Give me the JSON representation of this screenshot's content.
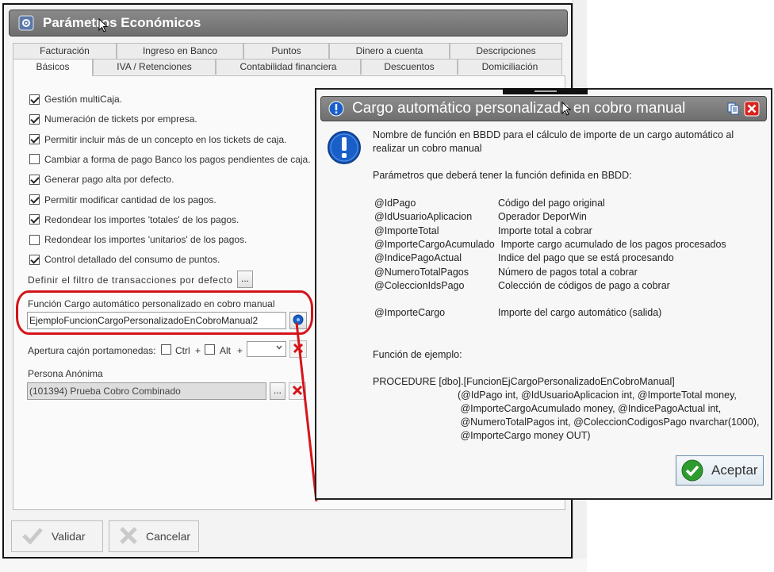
{
  "main_window": {
    "title": "Parámetros Económicos",
    "tabs_row1": [
      "Facturación",
      "Ingreso en Banco",
      "Puntos",
      "Dinero a cuenta",
      "Descripciones"
    ],
    "tabs_row2": [
      "Básicos",
      "IVA / Retenciones",
      "Contabilidad financiera",
      "Descuentos",
      "Domiciliación"
    ],
    "active_tab": "Básicos",
    "checkboxes": [
      {
        "label": "Gestión multiCaja.",
        "checked": true
      },
      {
        "label": "Numeración de tickets por empresa.",
        "checked": true
      },
      {
        "label": "Permitir incluir más de un concepto en los tickets de caja.",
        "checked": true
      },
      {
        "label": "Cambiar a forma de pago Banco los pagos pendientes de caja.",
        "checked": false
      },
      {
        "label": "Generar pago alta por defecto.",
        "checked": true
      },
      {
        "label": "Permitir modificar cantidad de los pagos.",
        "checked": true
      },
      {
        "label": "Redondear los importes 'totales' de los pagos.",
        "checked": true
      },
      {
        "label": "Redondear los importes 'unitarios' de los pagos.",
        "checked": false
      },
      {
        "label": "Control detallado del consumo de puntos.",
        "checked": true
      }
    ],
    "filter_label": "Definir el filtro de transacciones por defecto",
    "ellipsis": "...",
    "function_label": "Función Cargo automático personalizado en cobro manual",
    "function_value": "EjemploFuncionCargoPersonalizadoEnCobroManual2",
    "drawer_label": "Apertura cajón portamonedas:",
    "ctrl_label": "Ctrl",
    "alt_label": "Alt",
    "plus": "+",
    "anon_label": "Persona Anónima",
    "anon_value": "(101394) Prueba Cobro Combinado",
    "validate_label": "Validar",
    "cancel_label": "Cancelar"
  },
  "dialog": {
    "title": "Cargo automático personalizado en cobro manual",
    "intro_1": "Nombre de función en BBDD para el cálculo de importe de un cargo automático al",
    "intro_2": "realizar un cobro manual",
    "params_heading": "Parámetros que deberá tener la función definida en BBDD:",
    "params": [
      {
        "name": "@IdPago",
        "desc": "Código del pago original"
      },
      {
        "name": "@IdUsuarioAplicacion",
        "desc": "Operador DeporWin"
      },
      {
        "name": "@ImporteTotal",
        "desc": "Importe total a cobrar"
      },
      {
        "name": "@ImporteCargoAcumulado",
        "desc": " Importe cargo acumulado de los pagos procesados"
      },
      {
        "name": "@IndicePagoActual",
        "desc": "Indice del pago que se está procesando"
      },
      {
        "name": "@NumeroTotalPagos",
        "desc": "Número de pagos total a cobrar"
      },
      {
        "name": "@ColeccionIdsPago",
        "desc": "Colección de códigos de pago a cobrar"
      }
    ],
    "output_param": {
      "name": "@ImporteCargo",
      "desc": "Importe del cargo automático (salida)"
    },
    "example_heading": "Función de ejemplo:",
    "example_lines": [
      "PROCEDURE [dbo].[FuncionEjCargoPersonalizadoEnCobroManual]",
      "(@IdPago int, @IdUsuarioAplicacion int, @ImporteTotal money,",
      " @ImporteCargoAcumulado money, @IndicePagoActual int,",
      " @NumeroTotalPagos int, @ColeccionCodigosPago nvarchar(1000),",
      " @ImporteCargo money OUT)"
    ],
    "accept_label": "Aceptar"
  },
  "colors": {
    "annotation_red": "#d4141a",
    "title_gray": "#7a7a7a",
    "info_blue": "#1a5fc8"
  }
}
